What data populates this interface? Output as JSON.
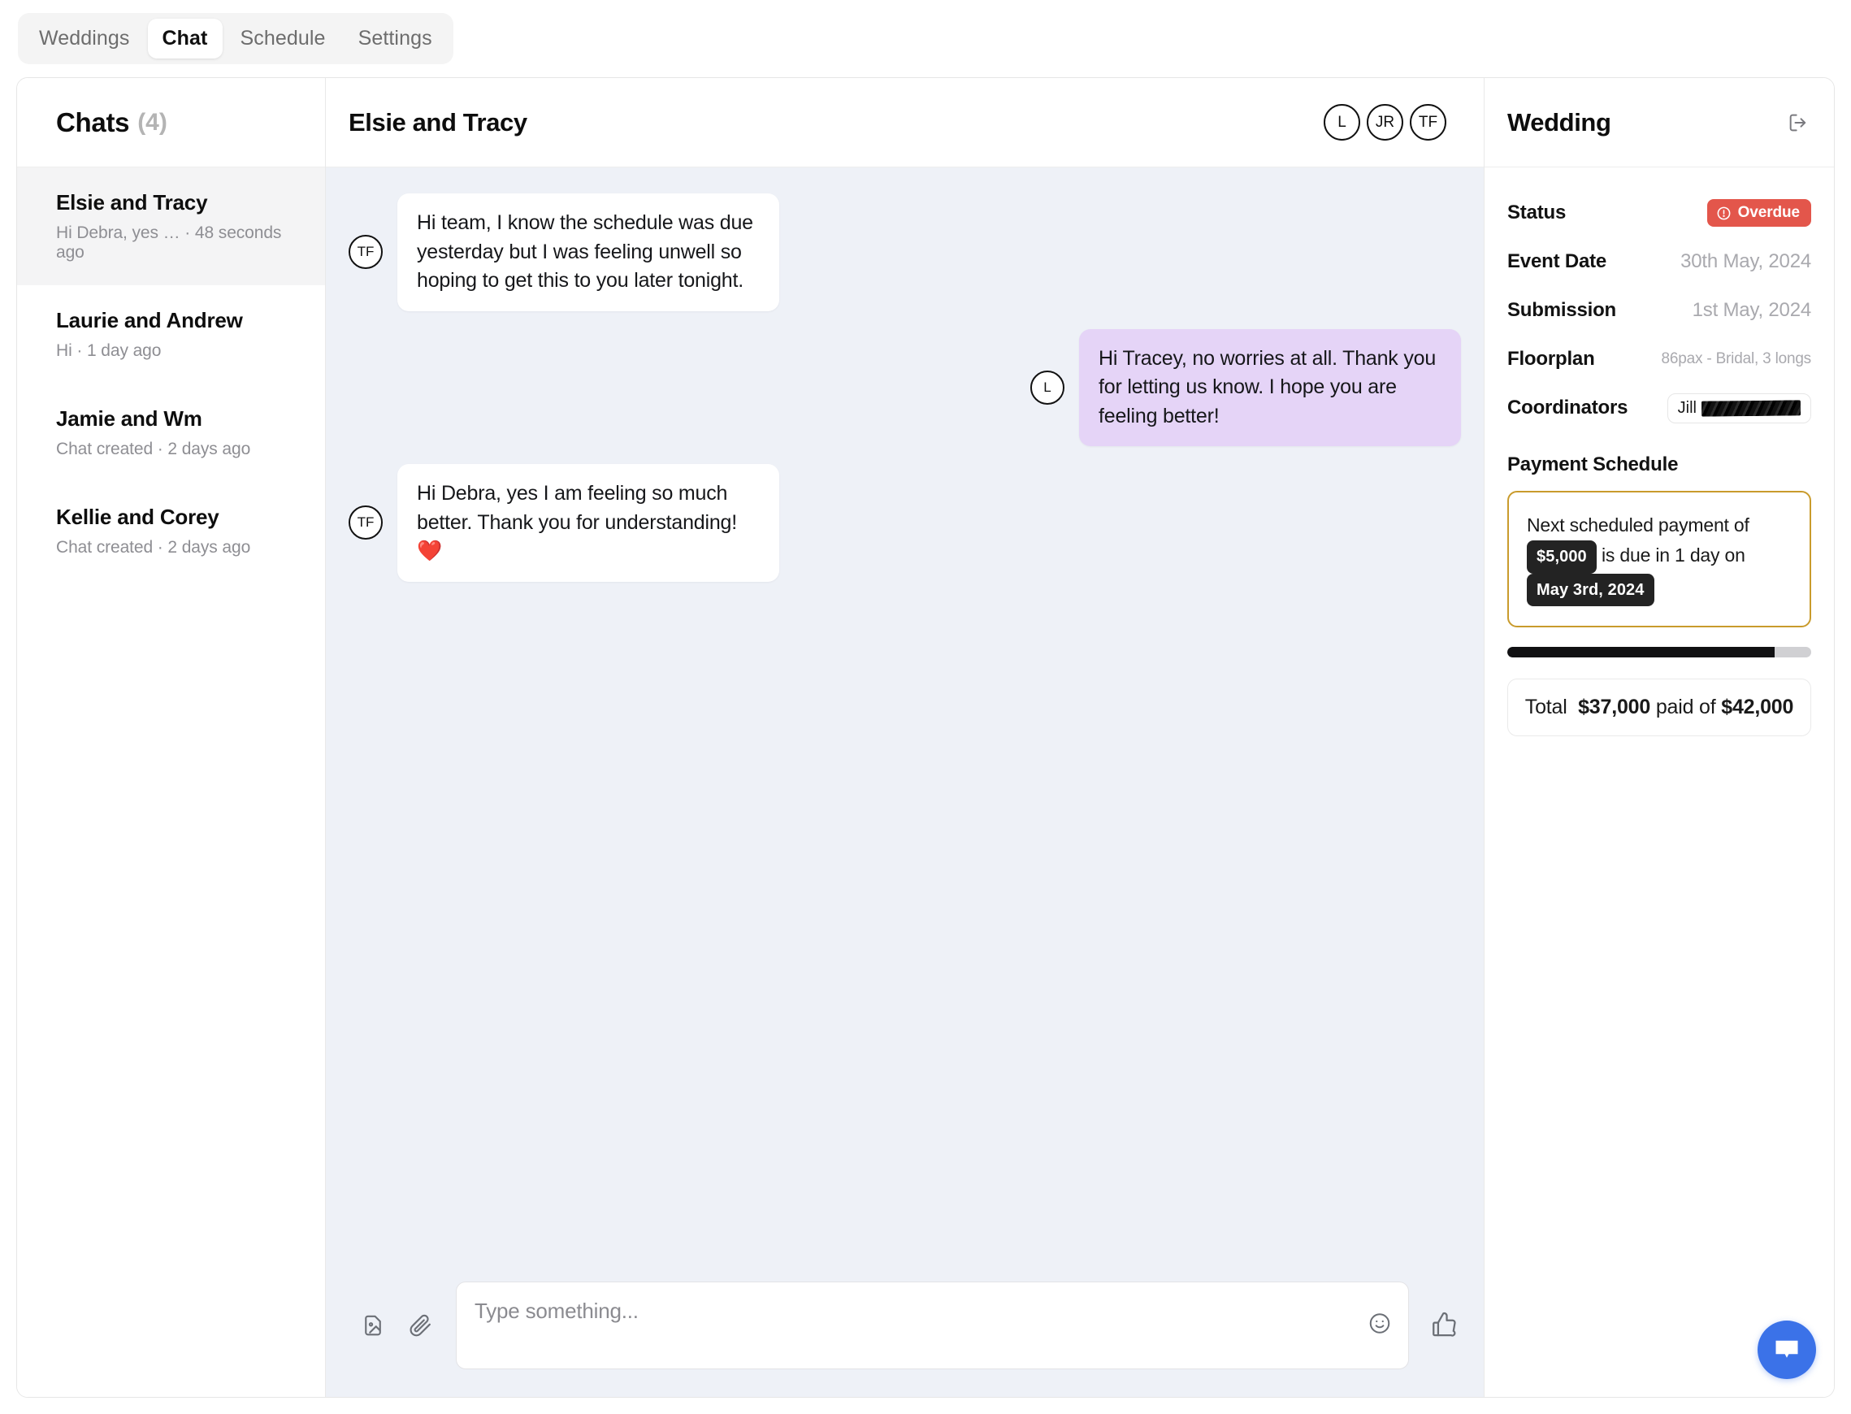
{
  "nav": {
    "tabs": [
      {
        "label": "Weddings",
        "active": false
      },
      {
        "label": "Chat",
        "active": true
      },
      {
        "label": "Schedule",
        "active": false
      },
      {
        "label": "Settings",
        "active": false
      }
    ]
  },
  "sidebar": {
    "title": "Chats",
    "count": "(4)",
    "items": [
      {
        "name": "Elsie and Tracy",
        "preview": "Hi Debra, yes … · 48 seconds ago",
        "selected": true
      },
      {
        "name": "Laurie and Andrew",
        "preview": "Hi · 1 day ago",
        "selected": false
      },
      {
        "name": "Jamie and Wm",
        "preview": "Chat created · 2 days ago",
        "selected": false
      },
      {
        "name": "Kellie and Corey",
        "preview": "Chat created · 2 days ago",
        "selected": false
      }
    ]
  },
  "chat": {
    "title": "Elsie and Tracy",
    "participants": [
      "L",
      "JR",
      "TF"
    ],
    "messages": [
      {
        "avatar": "TF",
        "text": "Hi team, I know the schedule was due yesterday but I was feeling unwell so hoping to get this to you later tonight.",
        "side": "in",
        "emoji": ""
      },
      {
        "avatar": "L",
        "text": "Hi Tracey, no worries at all. Thank you for letting us know. I hope you are feeling better!",
        "side": "out",
        "emoji": ""
      },
      {
        "avatar": "TF",
        "text": "Hi Debra, yes I am feeling so much better. Thank you for understanding!",
        "side": "in",
        "emoji": "❤️"
      }
    ],
    "composer": {
      "placeholder": "Type something...",
      "image_icon": "image-icon",
      "attach_icon": "paperclip-icon",
      "emoji_icon": "smiley-icon",
      "thumb_icon": "thumbs-up-icon"
    }
  },
  "wedding": {
    "title": "Wedding",
    "exit_icon": "exit-icon",
    "details": [
      {
        "label": "Status",
        "value": "Overdue",
        "type": "badge"
      },
      {
        "label": "Event Date",
        "value": "30th May, 2024",
        "type": "text"
      },
      {
        "label": "Submission",
        "value": "1st May, 2024",
        "type": "text"
      },
      {
        "label": "Floorplan",
        "value": "86pax - Bridal, 3 longs",
        "type": "small"
      },
      {
        "label": "Coordinators",
        "value": "Jill",
        "type": "pill"
      }
    ],
    "payment": {
      "section_title": "Payment Schedule",
      "line1": "Next scheduled payment of",
      "amount": "$5,000",
      "line2": "is due in 1 day on",
      "date": "May 3rd, 2024",
      "progress_percent": 88,
      "total_prefix": "Total",
      "paid": "$37,000",
      "paid_label": "paid of",
      "goal": "$42,000"
    }
  },
  "widget": {
    "icon": "chat-bubble-icon"
  },
  "colors": {
    "accent_red": "#e3564b",
    "accent_gold": "#c99b2c",
    "bubble_purple": "#e5d4f7",
    "chat_bg": "#eef1f7",
    "fab_blue": "#3b72e8"
  }
}
